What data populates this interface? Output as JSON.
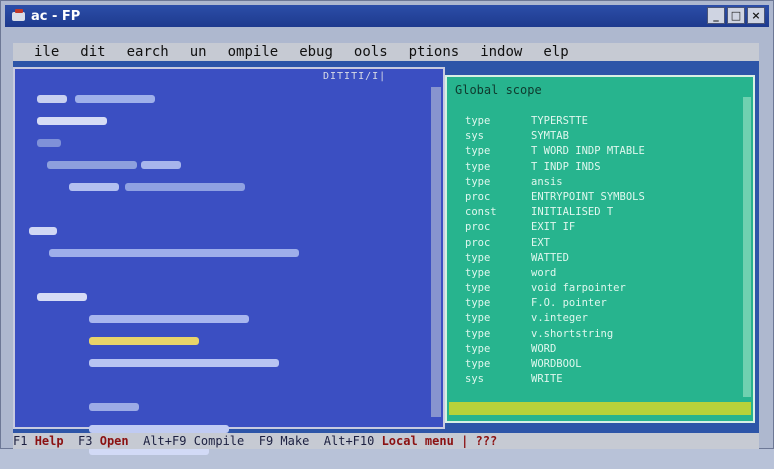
{
  "window": {
    "title": "ac - FP",
    "buttons": [
      "_",
      "□",
      "×"
    ]
  },
  "menu": [
    "ile",
    "dit",
    "earch",
    "un",
    "ompile",
    "ebug",
    "ools",
    "ptions",
    "indow",
    "elp"
  ],
  "editor": {
    "title": "DITITI/I|"
  },
  "scope": {
    "title": "Global scope",
    "rows": [
      {
        "kind": "type",
        "name": "TYPERSTTE"
      },
      {
        "kind": "sys",
        "name": "SYMTAB"
      },
      {
        "kind": "type",
        "name": "T WORD INDP MTABLE"
      },
      {
        "kind": "type",
        "name": "T INDP INDS"
      },
      {
        "kind": "type",
        "name": "ansis"
      },
      {
        "kind": "proc",
        "name": "ENTRYPOINT SYMBOLS"
      },
      {
        "kind": "const",
        "name": "INITIALISED T"
      },
      {
        "kind": "proc",
        "name": "EXIT IF"
      },
      {
        "kind": "proc",
        "name": "EXT"
      },
      {
        "kind": "type",
        "name": "WATTED"
      },
      {
        "kind": "type",
        "name": "word"
      },
      {
        "kind": "type",
        "name": "void farpointer"
      },
      {
        "kind": "type",
        "name": "F.O. pointer"
      },
      {
        "kind": "type",
        "name": "v.integer"
      },
      {
        "kind": "type",
        "name": "v.shortstring"
      },
      {
        "kind": "type",
        "name": "WORD"
      },
      {
        "kind": "type",
        "name": "WORDBOOL"
      },
      {
        "kind": "sys",
        "name": "WRITE"
      }
    ]
  },
  "status": {
    "k1": "F1",
    "l1": "Help",
    "k2": "F3",
    "l2": "Open",
    "k3": "Alt+F9",
    "l3": "Compile",
    "k4": "F9",
    "l4": "Make",
    "k5": "Alt+F10",
    "l5": "Local menu",
    "tail": "| ???"
  },
  "colors": {
    "editor_bg": "#3b4fc2",
    "scope_bg": "#27b48e",
    "menu_bg": "#c6cad3",
    "selection": "#b7d23a"
  }
}
